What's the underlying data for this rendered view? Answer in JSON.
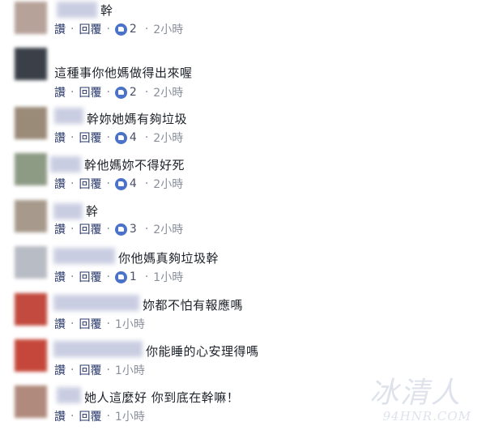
{
  "labels": {
    "like": "讚",
    "reply": "回覆",
    "sep": "·"
  },
  "colors": {
    "like_icon": "#4a72c8",
    "blur_name": "#c7cbe0"
  },
  "comments": [
    {
      "text": "幹",
      "likes": "2",
      "time": "2小時"
    },
    {
      "text": "這種事你他媽做得出來喔",
      "likes": "2",
      "time": "2小時"
    },
    {
      "text": "幹妳她媽有夠垃圾",
      "likes": "4",
      "time": "2小時"
    },
    {
      "text": "幹他媽妳不得好死",
      "likes": "4",
      "time": "2小時"
    },
    {
      "text": "幹",
      "likes": "3",
      "time": "2小時"
    },
    {
      "text": "你他媽真夠垃圾幹",
      "likes": "1",
      "time": "1小時"
    },
    {
      "text": "妳都不怕有報應嗎",
      "likes": "",
      "time": "1小時"
    },
    {
      "text": "你能睡的心安理得嗎",
      "likes": "",
      "time": "1小時"
    },
    {
      "text": "她人這麼好 你到底在幹嘛！",
      "likes": "",
      "time": "1小時"
    }
  ],
  "watermark": {
    "main": "冰清人",
    "url": "94HNR.COM"
  }
}
